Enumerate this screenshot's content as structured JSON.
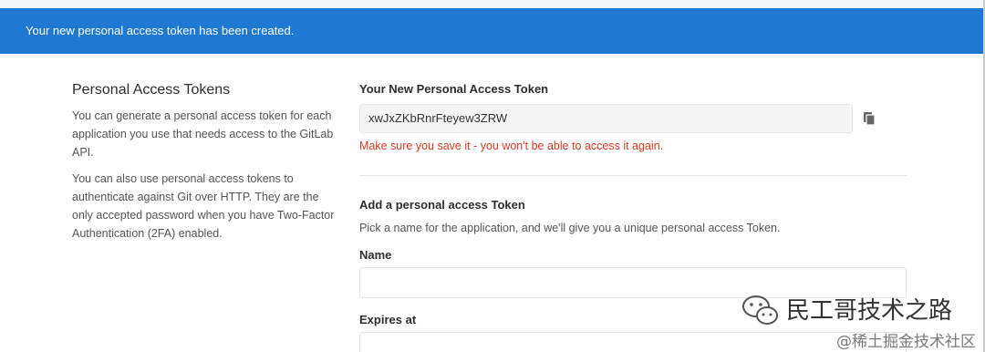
{
  "flash": {
    "message": "Your new personal access token has been created."
  },
  "left": {
    "title": "Personal Access Tokens",
    "p1": "You can generate a personal access token for each application you use that needs access to the GitLab API.",
    "p2": "You can also use personal access tokens to authenticate against Git over HTTP. They are the only accepted password when you have Two-Factor Authentication (2FA) enabled."
  },
  "new_token": {
    "label": "Your New Personal Access Token",
    "value": "xwJxZKbRnrFteyew3ZRW",
    "warning": "Make sure you save it - you won't be able to access it again."
  },
  "add_token": {
    "heading": "Add a personal access Token",
    "help": "Pick a name for the application, and we'll give you a unique personal access Token.",
    "name_label": "Name",
    "expires_label": "Expires at"
  },
  "watermark": {
    "line1": "民工哥技术之路",
    "line2": "@稀土掘金技术社区"
  },
  "colors": {
    "banner": "#1f78d1",
    "warning": "#db3b21"
  }
}
